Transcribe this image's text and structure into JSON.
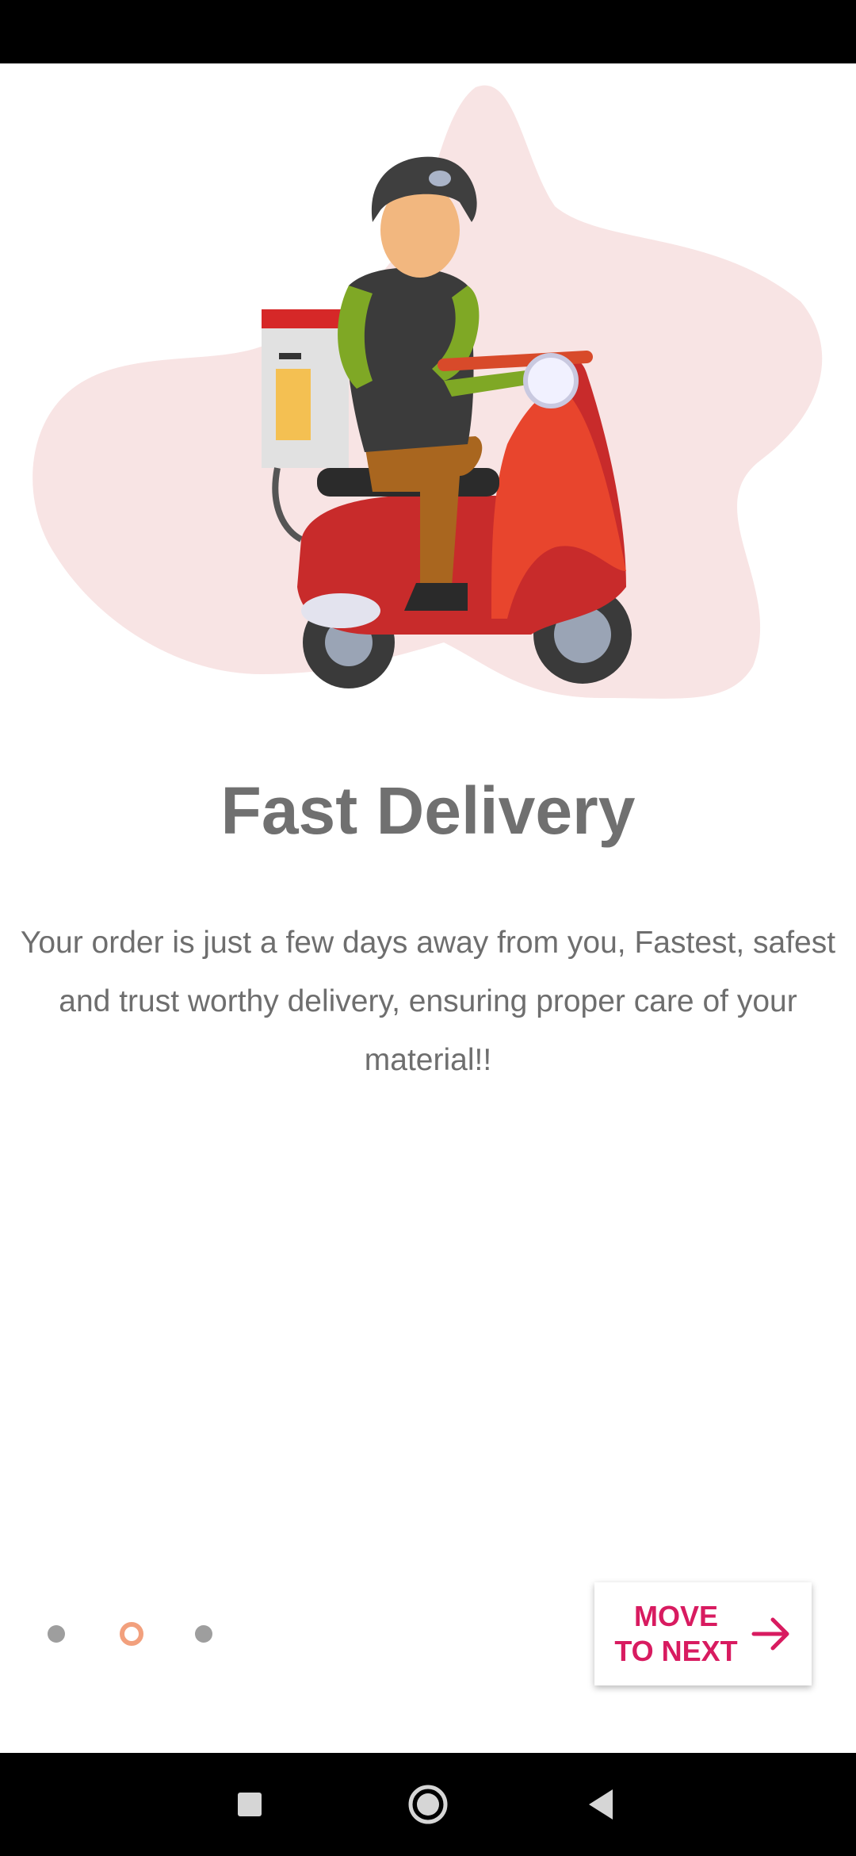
{
  "onboarding": {
    "title": "Fast Delivery",
    "description": "Your order is just a few days away from you, Fastest, safest and trust worthy  delivery, ensuring proper care of your material!!",
    "illustration": "delivery-scooter-rider-illustration",
    "pager": {
      "total": 3,
      "current_index": 1
    },
    "next_button_label": "MOVE TO NEXT",
    "next_icon": "arrow-right-icon"
  },
  "colors": {
    "accent": "#d81b60",
    "active_dot": "#f2a07d",
    "inactive_dot": "#9e9e9e",
    "blob": "#f8e4e4",
    "title": "#707070"
  },
  "nav_bar": {
    "icons": [
      "recent-apps-icon",
      "home-icon",
      "back-icon"
    ]
  }
}
